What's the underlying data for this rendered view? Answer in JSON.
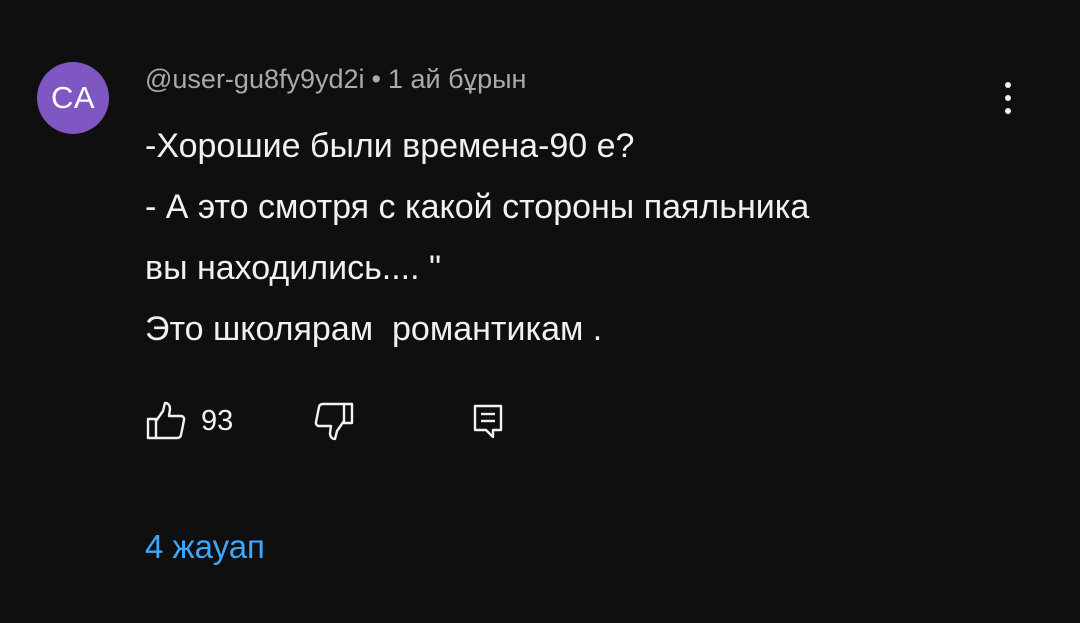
{
  "avatar": {
    "initials": "CA",
    "color": "#7e57c2"
  },
  "comment": {
    "author": "@user-gu8fy9yd2i",
    "separator": "•",
    "time": "1 ай бұрын",
    "lines": [
      "-Хорошие были времена-90 е?",
      "- А это смотря с какой стороны паяльника",
      "вы находились.... \"",
      "Это школярам  романтикам ."
    ]
  },
  "actions": {
    "like_icon": "thumbs-up-icon",
    "like_count": "93",
    "dislike_icon": "thumbs-down-icon",
    "reply_icon": "reply-icon",
    "menu_icon": "more-vertical-icon"
  },
  "replies": {
    "label": "4 жауап",
    "color": "#3ea6ff"
  },
  "colors": {
    "background": "#0f0f0f",
    "text": "#f1f1f1",
    "secondary_text": "#aaaaaa"
  }
}
